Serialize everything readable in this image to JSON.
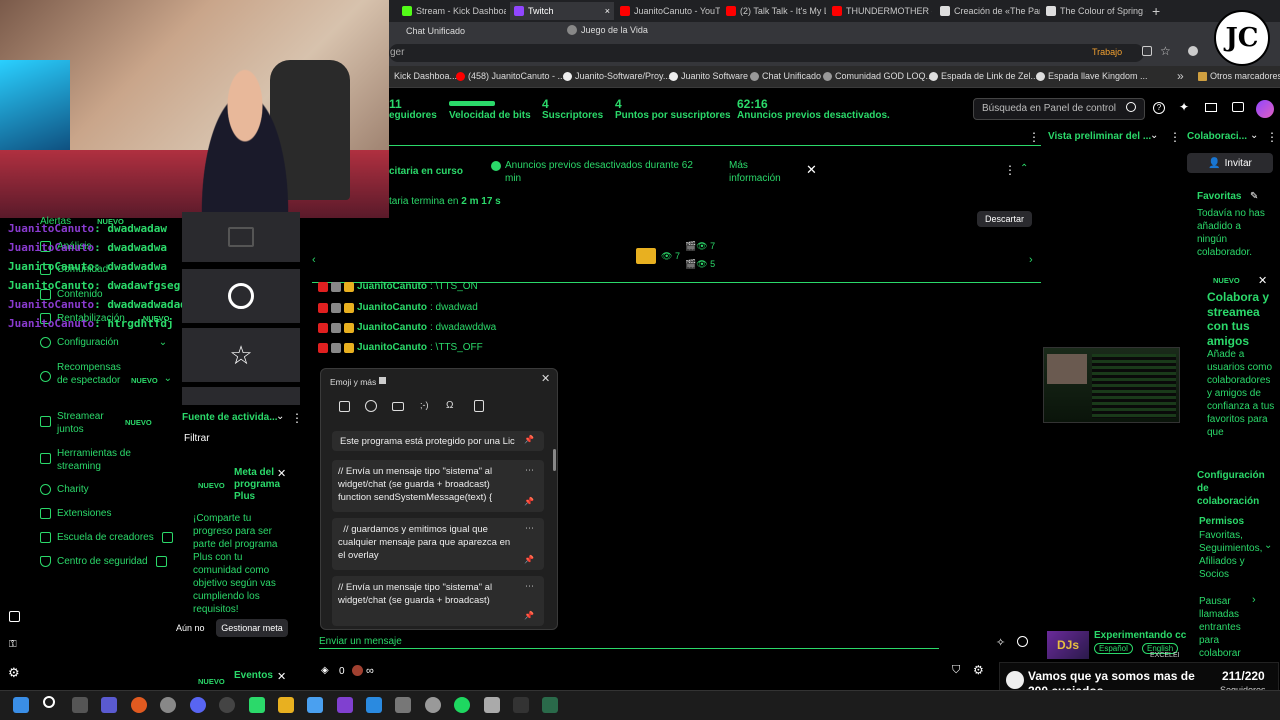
{
  "tabs": [
    {
      "label": "Stream - Kick Dashboa",
      "color": "#53fc18"
    },
    {
      "label": "Twitch",
      "color": "#9146ff",
      "active": true
    },
    {
      "label": "JuanitoCanuto - YouTu",
      "color": "#ff0000"
    },
    {
      "label": "(2) Talk Talk - It's My L",
      "color": "#ff0000"
    },
    {
      "label": "THUNDERMOTHER - It",
      "color": "#ff0000"
    },
    {
      "label": "Creación de «The Party",
      "color": "#dddddd"
    },
    {
      "label": "The Colour of Spring -",
      "color": "#dddddd"
    }
  ],
  "tab_close": "×",
  "new_tab": "+",
  "row2": {
    "tab1": "Chat Unificado",
    "tab2": "Juego de la Vida"
  },
  "address": {
    "partial": "ger",
    "work": "Trabajo"
  },
  "bookmarks": [
    "Kick Dashboa...",
    "(458) JuanitoCanuto - ...",
    "Juanito-Software/Proy...",
    "Juanito Software",
    "Chat Unificado",
    "Comunidad GOD LOQ...",
    "Espada de Link de Zel...",
    "Espada llave Kingdom ..."
  ],
  "bookmarks_more": "»",
  "bookmarks_other": "Otros marcadores",
  "stats": [
    {
      "num": "11",
      "label": "eguidores"
    },
    {
      "num": "",
      "label": "Velocidad de bits"
    },
    {
      "num": "4",
      "label": "Suscriptores"
    },
    {
      "num": "4",
      "label": "Puntos por suscriptores"
    },
    {
      "num": "62:16",
      "label": "Anuncios previos desactivados."
    }
  ],
  "search_placeholder": "Búsqueda en Panel de control",
  "panels": {
    "preview": "Vista preliminar del ...",
    "collab": "Colaboraci..."
  },
  "ad": {
    "left": "citaria en curso",
    "notice": "Anuncios previos desactivados durante 62 min",
    "more": "Más información",
    "ends_prefix": "taria termina en ",
    "ends_time": "2 m 17 s",
    "dismiss": "Descartar"
  },
  "viewers": {
    "a": "7",
    "b": "7",
    "c": "5"
  },
  "invite": "Invitar",
  "nav": [
    {
      "label": "Alertas",
      "nuevo": true
    },
    {
      "label": "Análisis"
    },
    {
      "label": "Comunidad"
    },
    {
      "label": "Contenido"
    },
    {
      "label": "Rentabilización",
      "nuevo": true
    },
    {
      "label": "Configuración"
    },
    {
      "label": "Recompensas de espectador",
      "nuevo": true
    },
    {
      "label": "Streamear juntos",
      "nuevo": true
    },
    {
      "label": "Herramientas de streaming"
    },
    {
      "label": "Charity"
    },
    {
      "label": "Extensiones"
    },
    {
      "label": "Escuela de creadores"
    },
    {
      "label": "Centro de seguridad"
    }
  ],
  "nuevo": "NUEVO",
  "overlay_chat": [
    {
      "user": "JuanitoCanuto",
      "msg": ": dwadwadaw"
    },
    {
      "user": "JuanitoCanuto",
      "msg": ": dwadwadwa"
    },
    {
      "user": "JuanitoCanuto",
      "msg": ": dwadwadwa"
    },
    {
      "user": "JuanitoCanuto",
      "msg": ": dwadawfgseg"
    },
    {
      "user": "JuanitoCanuto",
      "msg": ": dwadwadwadad"
    },
    {
      "user": "JuanitoCanuto",
      "msg": ": htrgdhtfdj"
    }
  ],
  "activity": {
    "title": "Fuente de activida...",
    "filter": "Filtrar",
    "goal_title": "Meta del programa Plus",
    "goal_body": "¡Comparte tu progreso para ser parte del programa Plus con tu comunidad como objetivo según vas cumpliendo los requisitos!",
    "not_now": "Aún no",
    "manage": "Gestionar meta",
    "events": "Eventos"
  },
  "chat": [
    {
      "user": "JuanitoCanuto",
      "msg": ": \\TTS_ON"
    },
    {
      "user": "JuanitoCanuto",
      "msg": ": dwadwad"
    },
    {
      "user": "JuanitoCanuto",
      "msg": ": dwadawddwa"
    },
    {
      "user": "JuanitoCanuto",
      "msg": ": \\TTS_OFF"
    }
  ],
  "emoji_panel": {
    "title": "Emoji y más",
    "items": [
      "Este programa está protegido por una Lic",
      "// Envía un mensaje tipo \"sistema\" al widget/chat (se guarda + broadcast)\nfunction sendSystemMessage(text) {",
      "  // guardamos y emitimos igual que cualquier mensaje para que aparezca en el overlay",
      "// Envía un mensaje tipo \"sistema\" al widget/chat (se guarda + broadcast)"
    ]
  },
  "send_placeholder": "Enviar un mensaje",
  "points": "0",
  "infinity": "∞",
  "favorites": {
    "title": "Favoritas",
    "body": "Todavía no has añadido a ningún colaborador."
  },
  "collab_promo": {
    "title": "Colabora y streamea con tus amigos",
    "body": "Añade a usuarios como colaboradores y amigos de confianza a tus favoritos para que"
  },
  "collab_config": "Configuración de colaboración",
  "permissions": {
    "title": "Permisos",
    "body": "Favoritas, Seguimientos, Afiliados y Socios"
  },
  "pause_calls": "Pausar llamadas entrantes para colaborar",
  "recommended": {
    "title": "Experimentando cc",
    "tag1": "Español",
    "tag2": "English",
    "tag3": "EXCELEI"
  },
  "goal": {
    "text": "Vamos que ya somos mas de 200 cuajados",
    "count": "211/220",
    "label": "Seguidores",
    "progress": 0.959
  },
  "colors": {
    "accent": "#2bd96a",
    "twitch": "#9146ff"
  }
}
